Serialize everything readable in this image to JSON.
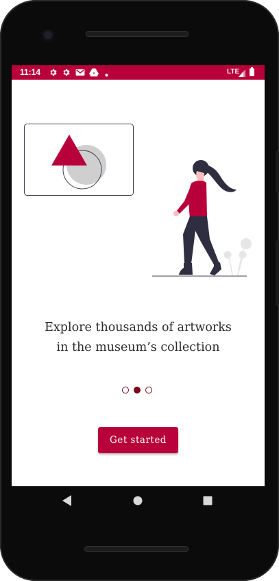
{
  "status_bar": {
    "time": "11:14",
    "network": "LTE",
    "notification_icons": [
      "gear-icon",
      "gear-icon",
      "gmail-icon",
      "drive-icon",
      "dot-icon"
    ],
    "accent": "#b8003a"
  },
  "onboarding": {
    "headline_line1": "Explore thousands of artworks",
    "headline_line2": "in the museum’s collection",
    "page_indicator": {
      "pages": 3,
      "active": 2
    },
    "cta_label": "Get started"
  },
  "colors": {
    "primary": "#b8003a",
    "indicator": "#7a0a1d",
    "text": "#2b2b2b"
  },
  "navigation_bar": {
    "buttons": [
      "back-icon",
      "home-icon",
      "recents-icon"
    ]
  }
}
